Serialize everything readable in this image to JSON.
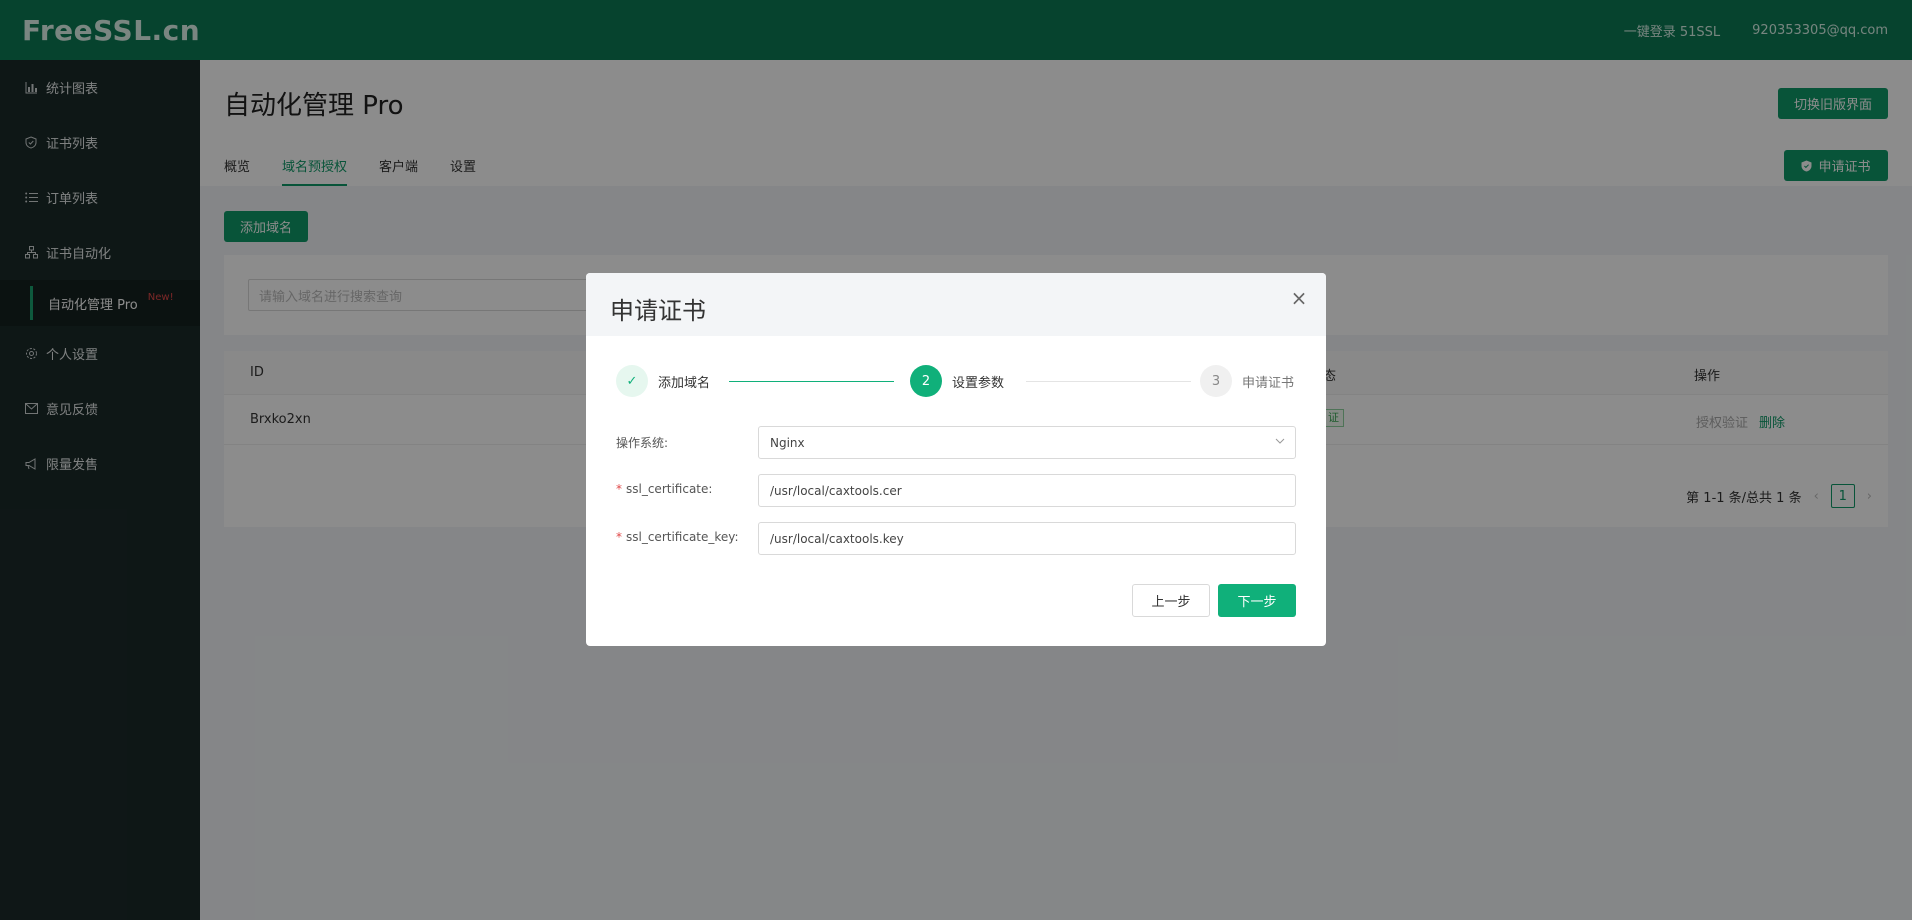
{
  "app": {
    "logo": "FreeSSL.cn"
  },
  "header": {
    "quick_login": "一键登录 51SSL",
    "user_email": "920353305@qq.com"
  },
  "sidebar": {
    "items": [
      {
        "label": "统计图表",
        "icon": "bar-chart-icon"
      },
      {
        "label": "证书列表",
        "icon": "shield-icon"
      },
      {
        "label": "订单列表",
        "icon": "list-icon"
      },
      {
        "label": "证书自动化",
        "icon": "hierarchy-icon"
      },
      {
        "label": "个人设置",
        "icon": "gear-icon"
      },
      {
        "label": "意见反馈",
        "icon": "mail-icon"
      },
      {
        "label": "限量发售",
        "icon": "megaphone-icon"
      }
    ],
    "sub_item": {
      "label": "自动化管理 Pro",
      "badge": "New!"
    }
  },
  "page": {
    "title": "自动化管理 Pro",
    "switch_old_button": "切换旧版界面",
    "apply_cert_button": "申请证书",
    "tabs": [
      "概览",
      "域名预授权",
      "客户端",
      "设置"
    ],
    "active_tab": 1,
    "add_domain_button": "添加域名",
    "search_placeholder": "请输入域名进行搜索查询"
  },
  "table": {
    "columns": [
      "ID",
      "态",
      "操作"
    ],
    "rows": [
      {
        "id": "Brxko2xn",
        "status_tag": "证",
        "action_verify": "授权验证",
        "action_delete": "删除"
      }
    ],
    "pagination": {
      "summary": "第 1-1 条/总共 1 条",
      "current_page": "1",
      "prev": "‹",
      "next": "›"
    }
  },
  "modal": {
    "title": "申请证书",
    "close": "×",
    "steps": [
      {
        "label": "添加域名",
        "marker": "✓",
        "state": "done"
      },
      {
        "label": "设置参数",
        "marker": "2",
        "state": "active"
      },
      {
        "label": "申请证书",
        "marker": "3",
        "state": "pending"
      }
    ],
    "fields": {
      "os_label": "操作系统:",
      "os_value": "Nginx",
      "cert_label": "ssl_certificate:",
      "cert_value": "/usr/local/caxtools.cer",
      "key_label": "ssl_certificate_key:",
      "key_value": "/usr/local/caxtools.key",
      "required_mark": "*"
    },
    "prev_button": "上一步",
    "next_button": "下一步"
  },
  "colors": {
    "brand": "#0b7a55",
    "accent": "#0f9a68",
    "step_active": "#10b07a",
    "sidebar": "#1b2a29",
    "danger": "#e04848"
  }
}
